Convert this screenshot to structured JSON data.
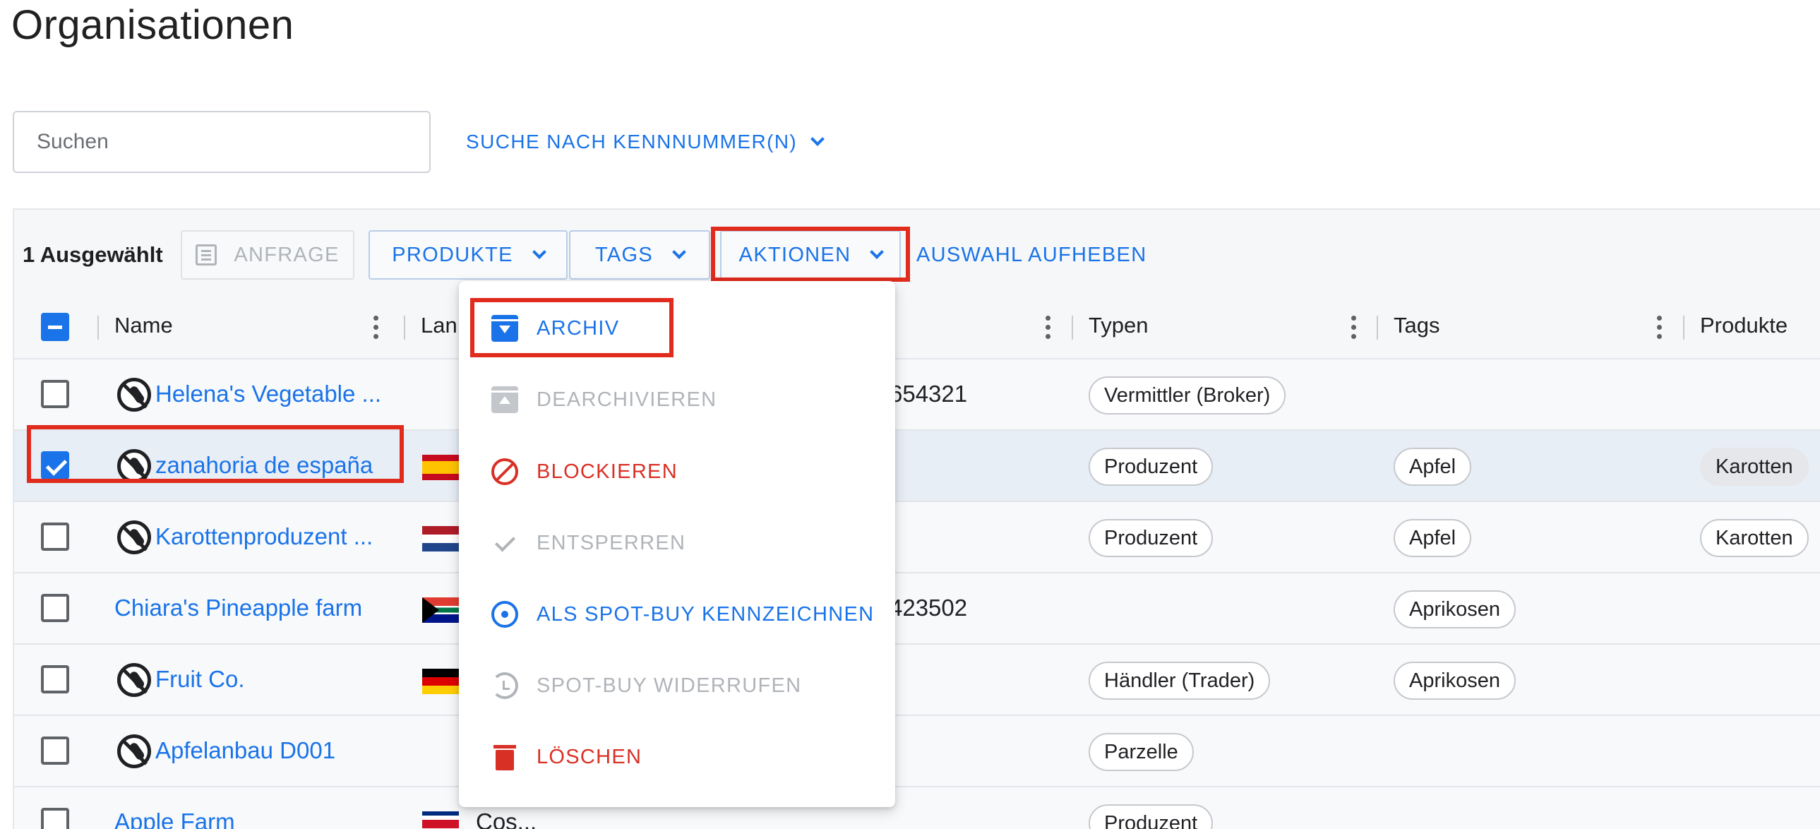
{
  "page": {
    "title": "Organisationen"
  },
  "search": {
    "placeholder": "Suchen",
    "id_search_label": "SUCHE NACH KENNNUMMER(N)"
  },
  "toolbar": {
    "selected_count": "1 Ausgewählt",
    "anfrage_label": "ANFRAGE",
    "produkte_label": "PRODUKTE",
    "tags_label": "TAGS",
    "aktionen_label": "AKTIONEN",
    "auswahl_aufheben_label": "AUSWAHL AUFHEBEN"
  },
  "table": {
    "columns": {
      "name": "Name",
      "land": "Lan",
      "typen": "Typen",
      "tags": "Tags",
      "produkte": "Produkte"
    },
    "rows": [
      {
        "name": "Helena's Vegetable ...",
        "blocked": true,
        "checked": false,
        "flag": "",
        "country": "",
        "id": "654321",
        "typ": "Vermittler (Broker)",
        "tag": "",
        "produkt": ""
      },
      {
        "name": "zanahoria de españa",
        "blocked": true,
        "checked": true,
        "flag": "es",
        "country": "",
        "id": "",
        "typ": "Produzent",
        "tag": "Apfel",
        "produkt": "Karotten"
      },
      {
        "name": "Karottenproduzent ...",
        "blocked": true,
        "checked": false,
        "flag": "nl",
        "country": "",
        "id": "",
        "typ": "Produzent",
        "tag": "Apfel",
        "produkt": "Karotten"
      },
      {
        "name": "Chiara's Pineapple farm",
        "blocked": false,
        "checked": false,
        "flag": "za",
        "country": "",
        "id": "423502",
        "typ": "",
        "tag": "Aprikosen",
        "produkt": ""
      },
      {
        "name": "Fruit Co.",
        "blocked": true,
        "checked": false,
        "flag": "de",
        "country": "",
        "id": "",
        "typ": "Händler (Trader)",
        "tag": "Aprikosen",
        "produkt": ""
      },
      {
        "name": "Apfelanbau D001",
        "blocked": true,
        "checked": false,
        "flag": "",
        "country": "",
        "id": "",
        "typ": "Parzelle",
        "tag": "",
        "produkt": ""
      },
      {
        "name": "Apple Farm",
        "blocked": false,
        "checked": false,
        "flag": "cr",
        "country": "Cos...",
        "id": "",
        "typ": "Produzent",
        "tag": "",
        "produkt": ""
      }
    ]
  },
  "actions_menu": {
    "items": [
      {
        "label": "ARCHIV",
        "icon": "archive-icon",
        "state": "enabled"
      },
      {
        "label": "DEARCHIVIEREN",
        "icon": "unarchive-icon",
        "state": "disabled"
      },
      {
        "label": "BLOCKIEREN",
        "icon": "block-icon",
        "state": "danger"
      },
      {
        "label": "ENTSPERREN",
        "icon": "check-icon",
        "state": "disabled"
      },
      {
        "label": "ALS SPOT-BUY KENNZEICHNEN",
        "icon": "spot-buy-icon",
        "state": "enabled"
      },
      {
        "label": "SPOT-BUY WIDERRUFEN",
        "icon": "revoke-icon",
        "state": "disabled"
      },
      {
        "label": "LÖSCHEN",
        "icon": "trash-icon",
        "state": "danger"
      }
    ]
  },
  "colors": {
    "primary": "#1a73e8",
    "danger": "#d93025",
    "highlight": "#e02b1d",
    "disabled": "#b0b4b9"
  }
}
